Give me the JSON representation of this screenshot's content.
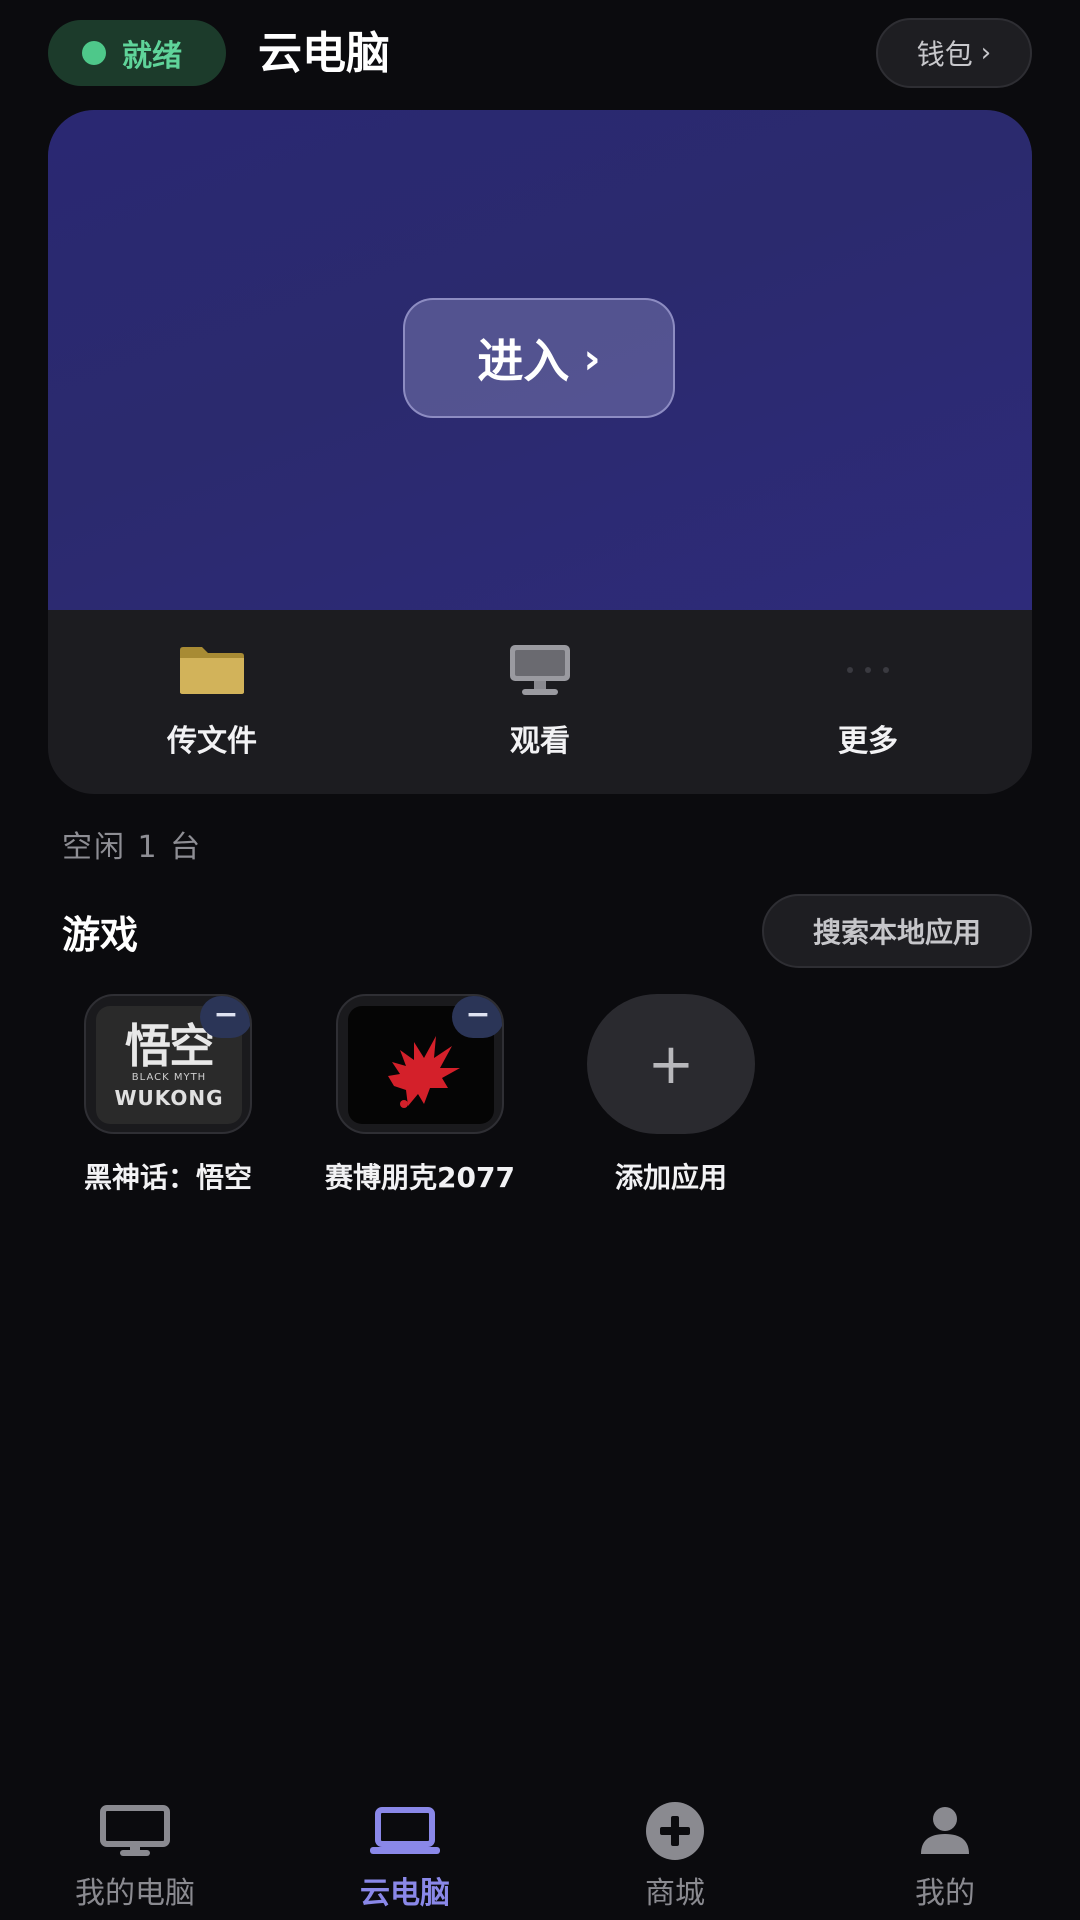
{
  "header": {
    "status_label": "就绪",
    "title": "云电脑",
    "wallet_label": "钱包",
    "wallet_chevron": "›"
  },
  "card": {
    "enter_label": "进入",
    "enter_chevron": "›",
    "actions": [
      {
        "label": "传文件",
        "icon": "folder-icon"
      },
      {
        "label": "观看",
        "icon": "monitor-icon"
      },
      {
        "label": "更多",
        "icon": "more-dots-icon"
      }
    ]
  },
  "idle_text": "空闲 1 台",
  "games": {
    "title": "游戏",
    "search_label": "搜索本地应用",
    "apps": [
      {
        "label": "黑神话：悟空",
        "removable": true
      },
      {
        "label": "赛博朋克2077",
        "removable": true
      },
      {
        "label": "添加应用",
        "removable": false
      }
    ],
    "remove_symbol": "−",
    "add_symbol": "+",
    "wukong_art": {
      "top": "悟空",
      "sub": "BLACK MYTH",
      "bottom": "WUKONG"
    }
  },
  "nav": {
    "items": [
      {
        "label": "我的电脑",
        "icon": "desktop-icon",
        "active": false
      },
      {
        "label": "云电脑",
        "icon": "laptop-icon",
        "active": true
      },
      {
        "label": "商城",
        "icon": "store-plus-icon",
        "active": false
      },
      {
        "label": "我的",
        "icon": "person-icon",
        "active": false
      }
    ]
  },
  "colors": {
    "background": "#0b0b0e",
    "ready_green": "#5fd49a",
    "hero_purple": "#2b2a6e",
    "active_nav": "#8a88e8"
  }
}
